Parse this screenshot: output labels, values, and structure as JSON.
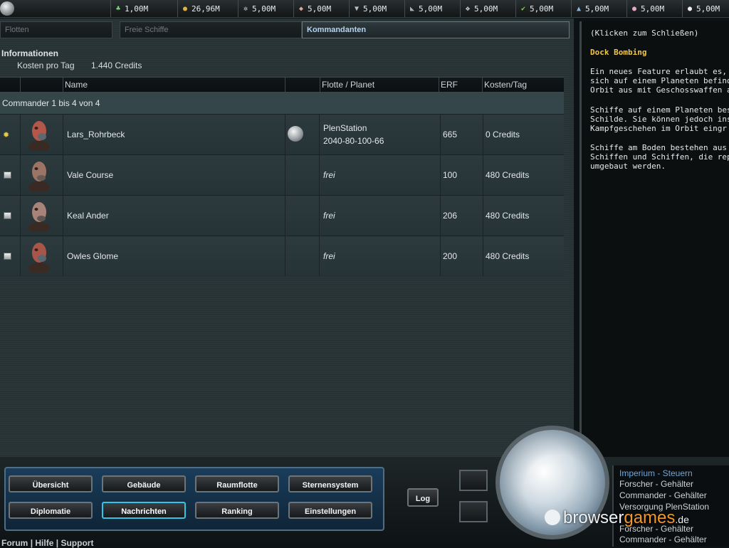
{
  "resources": [
    {
      "icon": "energy-icon",
      "value": "1,00M"
    },
    {
      "icon": "credits-icon",
      "value": "26,96M"
    },
    {
      "icon": "resource-3-icon",
      "value": "5,00M"
    },
    {
      "icon": "resource-4-icon",
      "value": "5,00M"
    },
    {
      "icon": "resource-5-icon",
      "value": "5,00M"
    },
    {
      "icon": "resource-6-icon",
      "value": "5,00M"
    },
    {
      "icon": "resource-7-icon",
      "value": "5,00M"
    },
    {
      "icon": "resource-8-icon",
      "value": "5,00M"
    },
    {
      "icon": "resource-9-icon",
      "value": "5,00M"
    },
    {
      "icon": "resource-10-icon",
      "value": "5,00M"
    },
    {
      "icon": "resource-11-icon",
      "value": "5,00M"
    }
  ],
  "tabs": [
    {
      "label": "Flotten",
      "active": false
    },
    {
      "label": "Freie Schiffe",
      "active": false
    },
    {
      "label": "Kommandanten",
      "active": true
    }
  ],
  "info": {
    "title": "Informationen",
    "costs_label": "Kosten pro Tag",
    "costs_value": "1.440 Credits"
  },
  "table": {
    "headers": {
      "name": "Name",
      "fleet": "Flotte / Planet",
      "erf": "ERF",
      "costs": "Kosten/Tag"
    },
    "group_label": "Commander 1 bis 4 von 4",
    "rows": [
      {
        "status": "star",
        "name": "Lars_Rohrbeck",
        "has_planet": true,
        "fleet_line1": "PlenStation",
        "fleet_line2": "2040-80-100-66",
        "erf": "665",
        "costs": "0 Credits"
      },
      {
        "status": "box",
        "name": "Vale Course",
        "has_planet": false,
        "fleet_line1": "frei",
        "fleet_line2": "",
        "erf": "100",
        "costs": "480 Credits"
      },
      {
        "status": "box",
        "name": "Keal Ander",
        "has_planet": false,
        "fleet_line1": "frei",
        "fleet_line2": "",
        "erf": "206",
        "costs": "480 Credits"
      },
      {
        "status": "box",
        "name": "Owles Glome",
        "has_planet": false,
        "fleet_line1": "frei",
        "fleet_line2": "",
        "erf": "200",
        "costs": "480 Credits"
      }
    ]
  },
  "news": {
    "close_hint": "(Klicken zum Schließen)",
    "title": "Dock Bombing",
    "paragraphs": [
      [
        "Ein neues Feature erlaubt es, Sc",
        "sich auf einem Planeten befinde",
        "Orbit aus mit Geschosswaffen an"
      ],
      [
        "Schiffe auf einem Planeten besi",
        "Schilde. Sie können jedoch ins",
        "Kampfgeschehen im Orbit eingr"
      ],
      [
        "Schiffe am Boden bestehen aus",
        "Schiffen und Schiffen, die repari",
        "umgebaut werden."
      ]
    ]
  },
  "nav": {
    "overview": "Übersicht",
    "buildings": "Gebäude",
    "space_fleet": "Raumflotte",
    "star_system": "Sternensystem",
    "diplomacy": "Diplomatie",
    "messages": "Nachrichten",
    "ranking": "Ranking",
    "settings": "Einstellungen",
    "log": "Log"
  },
  "expenses": [
    {
      "label": "Imperium - Steuern",
      "highlight": true
    },
    {
      "label": "Forscher - Gehälter",
      "highlight": false
    },
    {
      "label": "Commander - Gehälter",
      "highlight": false
    },
    {
      "label": "Versorgung PlenStation",
      "highlight": false
    },
    {
      "label": "Forscher - Gehälter",
      "highlight": false
    },
    {
      "label": "Commander - Gehälter",
      "highlight": false
    }
  ],
  "footer": {
    "forum": "Forum",
    "help": "Hilfe",
    "support": "Support",
    "sep": "|"
  },
  "watermark": {
    "part1": "browser",
    "part2": "games",
    "part3": ".de"
  }
}
